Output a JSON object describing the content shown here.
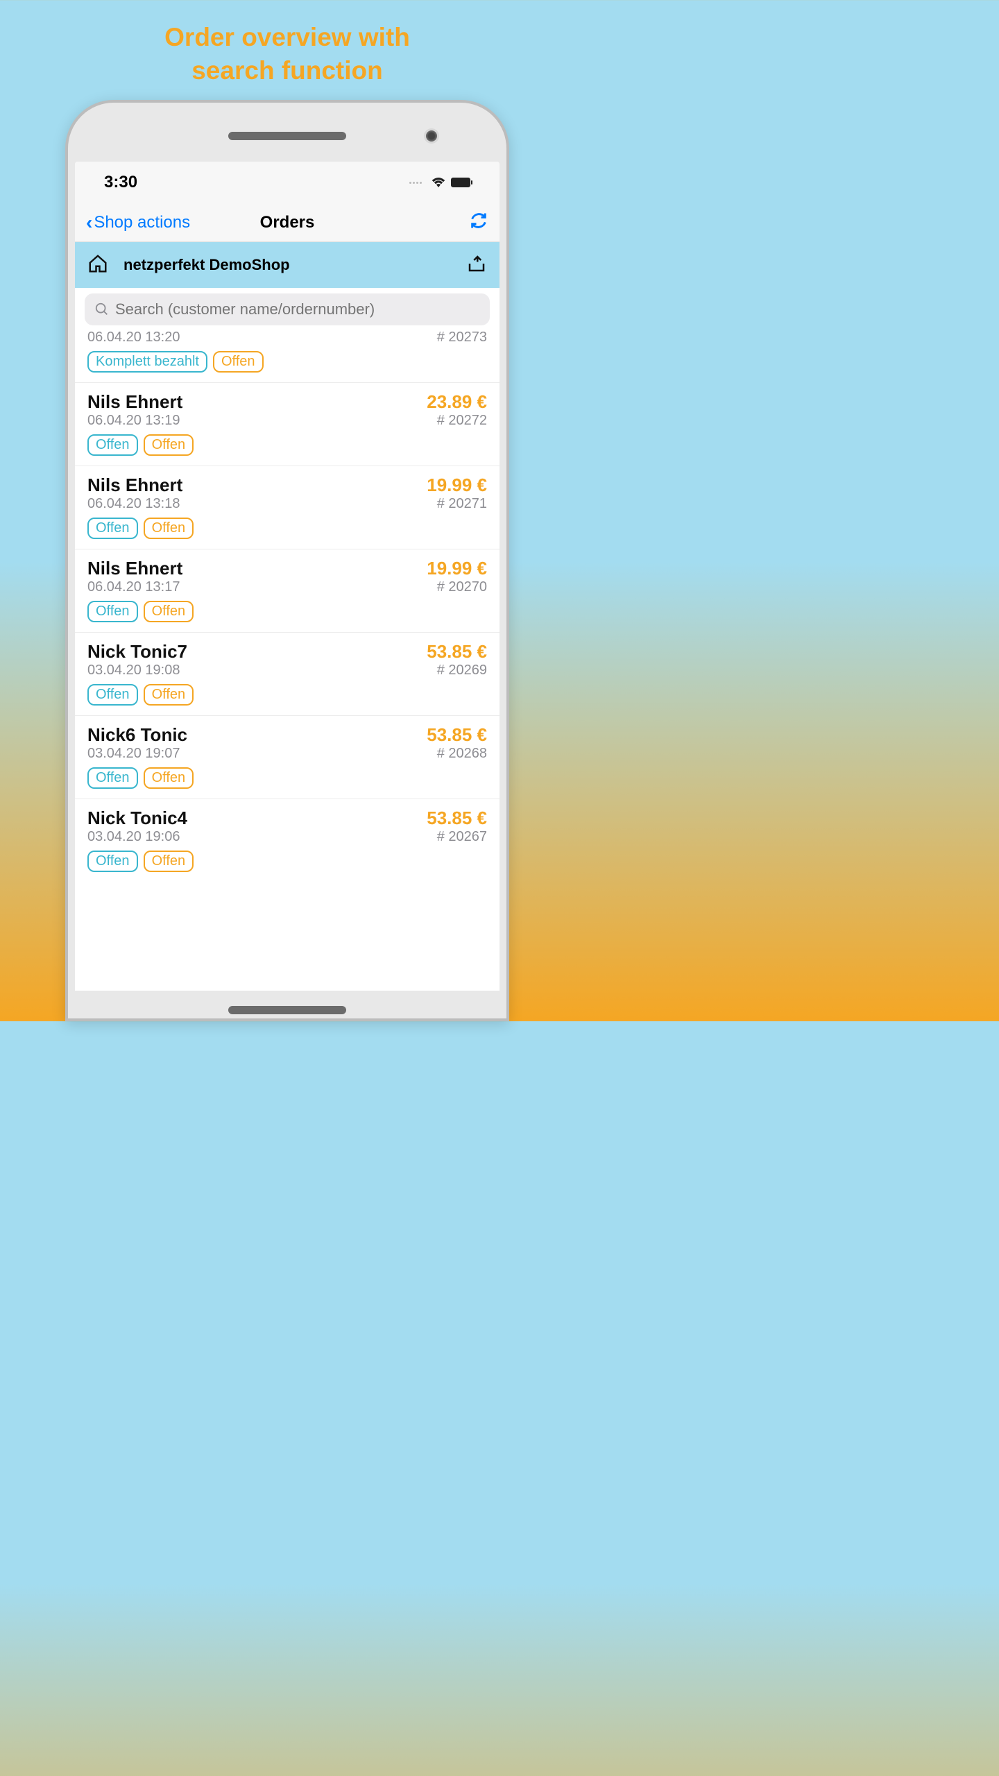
{
  "headline_line1": "Order overview with",
  "headline_line2": "search function",
  "status": {
    "time": "3:30"
  },
  "nav": {
    "back_label": "Shop actions",
    "title": "Orders"
  },
  "shop": {
    "name": "netzperfekt DemoShop"
  },
  "search": {
    "placeholder": "Search (customer name/ordernumber)"
  },
  "orders": [
    {
      "name": "",
      "amount": "",
      "date": "06.04.20 13:20",
      "ordernum": "# 20273",
      "chip1": "Komplett bezahlt",
      "chip2": "Offen",
      "partial": true
    },
    {
      "name": "Nils Ehnert",
      "amount": "23.89 €",
      "date": "06.04.20 13:19",
      "ordernum": "# 20272",
      "chip1": "Offen",
      "chip2": "Offen"
    },
    {
      "name": "Nils Ehnert",
      "amount": "19.99 €",
      "date": "06.04.20 13:18",
      "ordernum": "# 20271",
      "chip1": "Offen",
      "chip2": "Offen"
    },
    {
      "name": "Nils Ehnert",
      "amount": "19.99 €",
      "date": "06.04.20 13:17",
      "ordernum": "# 20270",
      "chip1": "Offen",
      "chip2": "Offen"
    },
    {
      "name": "Nick Tonic7",
      "amount": "53.85 €",
      "date": "03.04.20 19:08",
      "ordernum": "# 20269",
      "chip1": "Offen",
      "chip2": "Offen"
    },
    {
      "name": "Nick6 Tonic",
      "amount": "53.85 €",
      "date": "03.04.20 19:07",
      "ordernum": "# 20268",
      "chip1": "Offen",
      "chip2": "Offen"
    },
    {
      "name": "Nick Tonic4",
      "amount": "53.85 €",
      "date": "03.04.20 19:06",
      "ordernum": "# 20267",
      "chip1": "Offen",
      "chip2": "Offen"
    }
  ]
}
